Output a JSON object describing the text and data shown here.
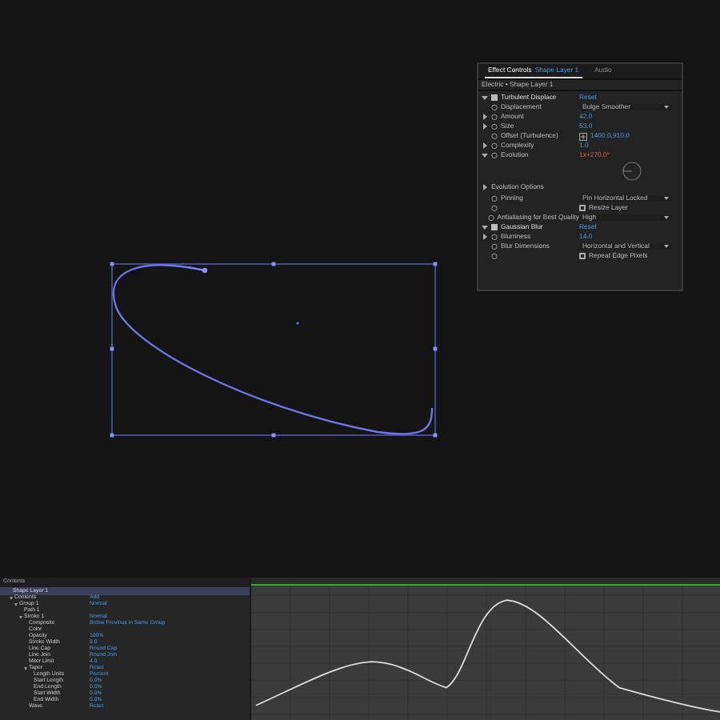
{
  "effect_controls": {
    "tabs": [
      {
        "label": "Effect Controls",
        "layer": "Shape Layer 1",
        "selected": true
      },
      {
        "label": "Audio",
        "selected": false
      }
    ],
    "subtitle": "Electric • Shape Layer 1",
    "rows": [
      {
        "kind": "effect",
        "label": "Turbulent Displace",
        "value": "Reset",
        "expanded": true
      },
      {
        "kind": "dropdown",
        "label": "Displacement",
        "value": "Bulge Smoother"
      },
      {
        "kind": "number",
        "label": "Amount",
        "value": "42.0",
        "expanded": false
      },
      {
        "kind": "number",
        "label": "Size",
        "value": "53.0",
        "expanded": false
      },
      {
        "kind": "point",
        "label": "Offset (Turbulence)",
        "value": "1400.0,910.0"
      },
      {
        "kind": "number",
        "label": "Complexity",
        "value": "1.0",
        "expanded": false
      },
      {
        "kind": "angle",
        "label": "Evolution",
        "value": "1x+270.0°",
        "expanded": true
      },
      {
        "kind": "group",
        "label": "Evolution Options",
        "expanded": false
      },
      {
        "kind": "dropdown",
        "label": "Pinning",
        "value": "Pin Horizontal Locked"
      },
      {
        "kind": "checkbox",
        "label": "Resize Layer",
        "checked": false
      },
      {
        "kind": "dropdown",
        "label": "Antialiasing for Best Quality",
        "value": "High"
      },
      {
        "kind": "effect",
        "label": "Gaussian Blur",
        "value": "Reset",
        "expanded": true
      },
      {
        "kind": "number",
        "label": "Blurriness",
        "value": "14.0",
        "expanded": false
      },
      {
        "kind": "dropdown",
        "label": "Blur Dimensions",
        "value": "Horizontal and Vertical"
      },
      {
        "kind": "checkbox",
        "label": "Repeat Edge Pixels",
        "checked": false
      }
    ]
  },
  "timeline": {
    "header": "Contents",
    "layer": "Shape Layer 1",
    "tree": [
      {
        "label": "Contents",
        "value": "Add",
        "children": [
          {
            "label": "Group 1",
            "value": "Normal",
            "children": [
              {
                "label": "Path 1"
              },
              {
                "label": "Stroke 1",
                "value": "Normal",
                "children": [
                  {
                    "label": "Composite",
                    "value": "Below Previous in Same Group"
                  },
                  {
                    "label": "Color"
                  },
                  {
                    "label": "Opacity",
                    "value": "100%"
                  },
                  {
                    "label": "Stroke Width",
                    "value": "9.0"
                  },
                  {
                    "label": "Line Cap",
                    "value": "Round Cap"
                  },
                  {
                    "label": "Line Join",
                    "value": "Round Join"
                  },
                  {
                    "label": "Miter Limit",
                    "value": "4.0"
                  },
                  {
                    "label": "Taper",
                    "value": "Reset",
                    "children": [
                      {
                        "label": "Length Units",
                        "value": "Percent"
                      },
                      {
                        "label": "Start Length",
                        "value": "0.0%"
                      },
                      {
                        "label": "End Length",
                        "value": "0.0%"
                      },
                      {
                        "label": "Start Width",
                        "value": "0.0%"
                      },
                      {
                        "label": "End Width",
                        "value": "0.0%"
                      }
                    ]
                  },
                  {
                    "label": "Wave",
                    "value": "Reset"
                  }
                ]
              }
            ]
          }
        ]
      }
    ]
  }
}
